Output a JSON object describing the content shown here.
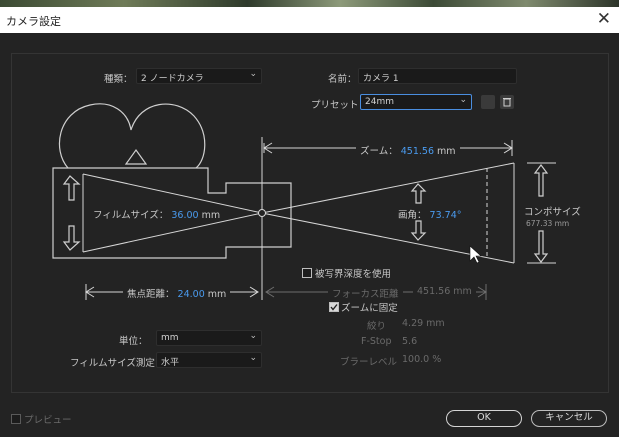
{
  "window": {
    "title": "カメラ設定",
    "close_glyph": "✕"
  },
  "type": {
    "label": "種類：",
    "value": "2 ノードカメラ"
  },
  "name": {
    "label": "名前：",
    "value": "カメラ 1"
  },
  "preset": {
    "label": "プリセット：",
    "value": "24mm"
  },
  "zoom": {
    "label": "ズーム：",
    "value": "451.56",
    "unit": "mm"
  },
  "film_size": {
    "label": "フィルムサイズ：",
    "value": "36.00",
    "unit": "mm"
  },
  "angle_of_view": {
    "label": "画角：",
    "value": "73.74",
    "unit": "°"
  },
  "comp_size": {
    "label": "コンポサイズ",
    "value": "677.33 mm"
  },
  "focal_length": {
    "label": "焦点距離：",
    "value": "24.00",
    "unit": "mm"
  },
  "depth_of_field": {
    "label": "被写界深度を使用",
    "checked": false
  },
  "focus_distance": {
    "label": "フォーカス距離",
    "value": "451.56 mm"
  },
  "lock_to_zoom": {
    "label": "ズームに固定",
    "checked": true
  },
  "aperture": {
    "label": "絞り",
    "value": "4.29 mm"
  },
  "fstop": {
    "label": "F-Stop",
    "value": "5.6"
  },
  "blur_level": {
    "label": "ブラーレベル",
    "value": "100.0 %"
  },
  "units": {
    "label": "単位：",
    "value": "mm"
  },
  "measure_film_size": {
    "label": "フィルムサイズ測定：",
    "value": "水平"
  },
  "footer": {
    "preview_label": "プレビュー",
    "ok_label": "OK",
    "cancel_label": "キャンセル"
  },
  "colors": {
    "value_blue": "#4a9bef",
    "background": "#232323",
    "line": "#d0d0d0"
  }
}
